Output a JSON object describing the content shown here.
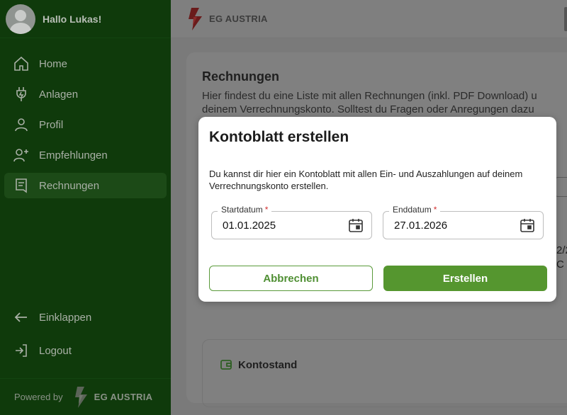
{
  "sidebar": {
    "greeting": "Hallo Lukas!",
    "items": [
      {
        "label": "Home",
        "icon": "home-icon"
      },
      {
        "label": "Anlagen",
        "icon": "plug-icon"
      },
      {
        "label": "Profil",
        "icon": "user-icon"
      },
      {
        "label": "Empfehlungen",
        "icon": "user-plus-icon"
      },
      {
        "label": "Rechnungen",
        "icon": "receipt-icon",
        "active": true
      }
    ],
    "collapse_label": "Einklappen",
    "logout_label": "Logout",
    "powered_by": "Powered by",
    "brand": "EG AUSTRIA"
  },
  "topbar": {
    "brand": "EG AUSTRIA"
  },
  "main": {
    "title": "Rechnungen",
    "desc_line1": "Hier findest du eine Liste mit allen Rechnungen (inkl. PDF Download) u",
    "desc_line2": "deinem Verrechnungskonto. Solltest du Fragen oder Anregungen dazu",
    "partial_right_1": "2/2",
    "partial_right_2": "C",
    "konto_title": "Kontostand"
  },
  "modal": {
    "title": "Kontoblatt erstellen",
    "description": "Du kannst dir hier ein Kontoblatt mit allen Ein- und Auszahlungen auf deinem Verrechnungskonto erstellen.",
    "start_label": "Startdatum",
    "start_value": "01.01.2025",
    "end_label": "Enddatum",
    "end_value": "27.01.2026",
    "required_mark": "*",
    "cancel_label": "Abbrechen",
    "create_label": "Erstellen"
  },
  "colors": {
    "sidebar_bg": "#0f3a0b",
    "accent": "#55962f",
    "required": "#d32f2f"
  }
}
